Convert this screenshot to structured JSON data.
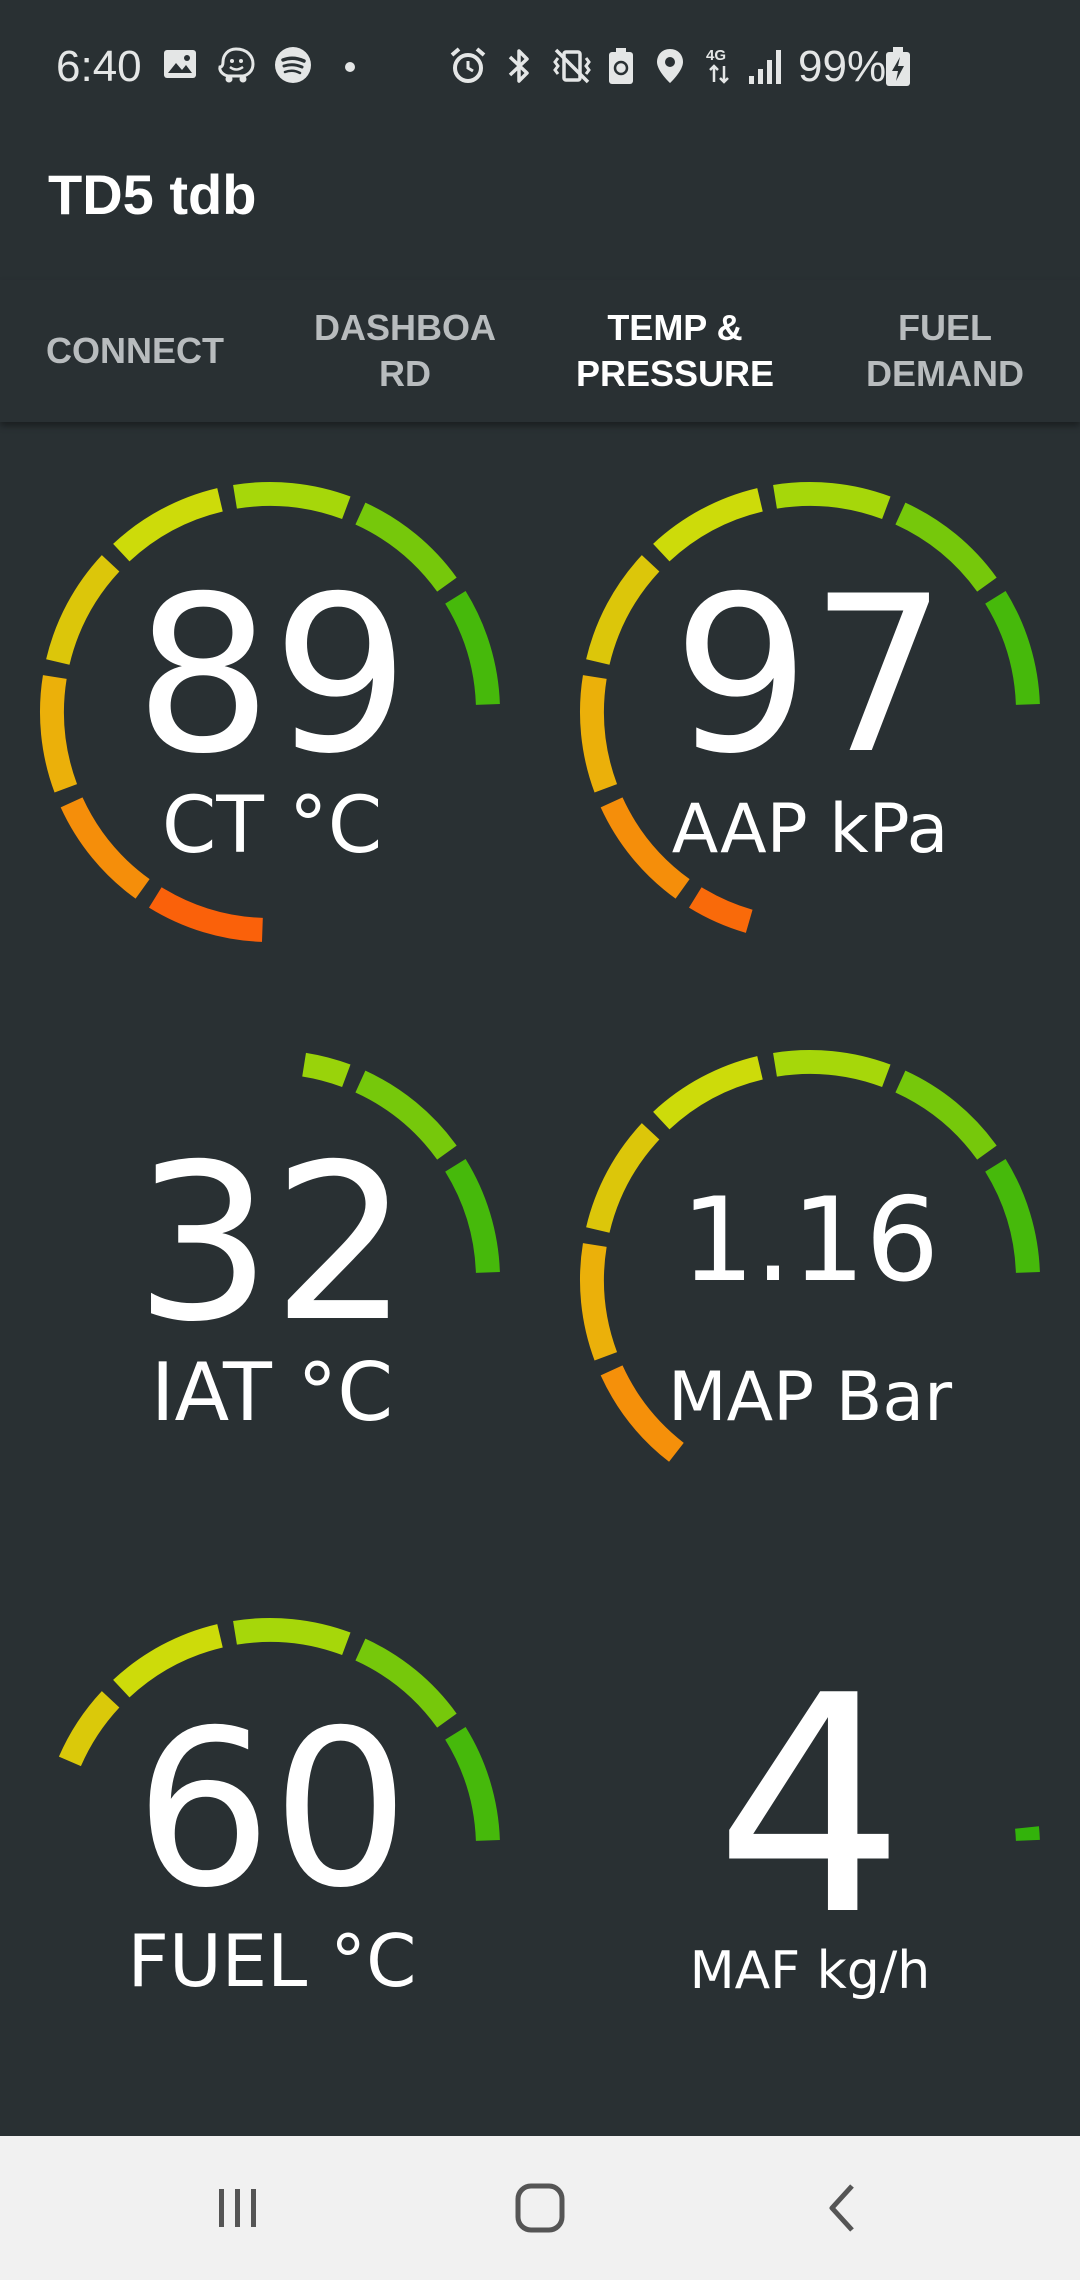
{
  "status_bar": {
    "time": "6:40",
    "battery_percent": "99%",
    "icons": [
      "image-icon",
      "waze-icon",
      "spotify-icon",
      "dot-icon",
      "alarm-icon",
      "bluetooth-icon",
      "vibrate-icon",
      "battery-saver-icon",
      "location-icon",
      "4g-icon",
      "signal-icon",
      "battery-charging-icon"
    ]
  },
  "app": {
    "title": "TD5 tdb"
  },
  "tabs": [
    {
      "label": "CONNECT",
      "active": false
    },
    {
      "label": "DASHBOA\nRD",
      "active": false
    },
    {
      "label": "TEMP &\nPRESSURE",
      "active": true
    },
    {
      "label": "FUEL\nDEMAND",
      "active": false
    }
  ],
  "gauges": [
    {
      "value": "89",
      "label": "CT °C",
      "fill": 1.0
    },
    {
      "value": "97",
      "label": "AAP kPa",
      "fill": 0.94
    },
    {
      "value": "32",
      "label": "IAT °C",
      "fill": 0.3
    },
    {
      "value": "1.16",
      "label": "MAP Bar",
      "fill": 0.86
    },
    {
      "value": "60",
      "label": "FUEL °C",
      "fill": 0.58
    },
    {
      "value": "4",
      "label": "MAF kg/h",
      "fill": 0.02
    }
  ],
  "colors": {
    "background": "#293033",
    "gauge_start": "#2eb10b",
    "gauge_mid": "#c8e20a",
    "gauge_high": "#f3a50a",
    "gauge_end": "#fc4a0a",
    "nav_bar": "#f1f1f1"
  },
  "nav_bar": {
    "icons": [
      "recent-apps-icon",
      "home-icon",
      "back-icon"
    ]
  }
}
